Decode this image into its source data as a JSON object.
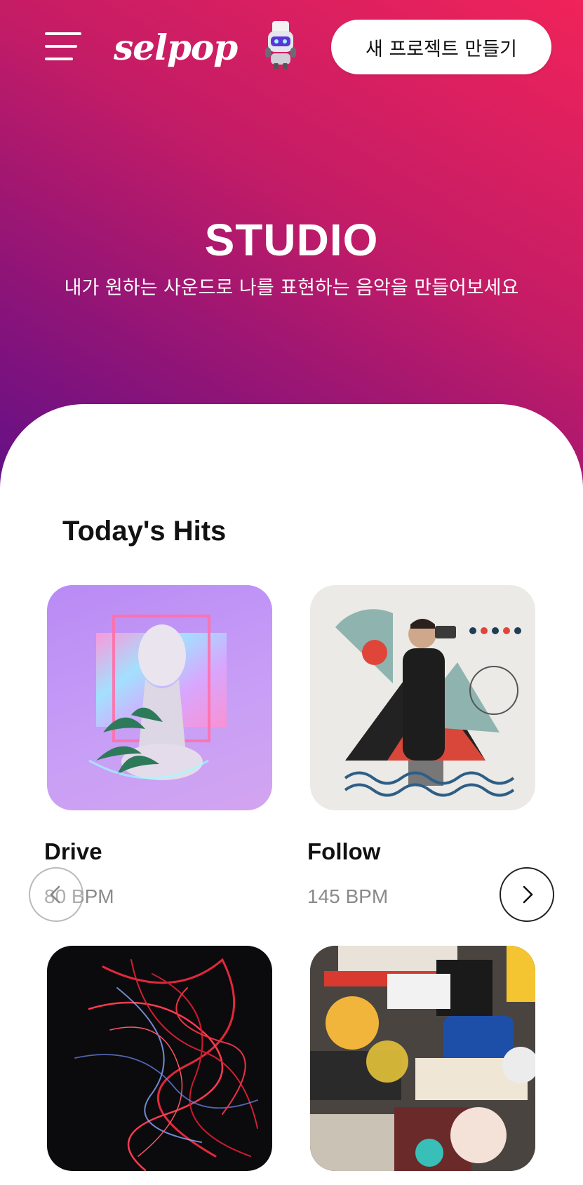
{
  "header": {
    "logo": "selpop",
    "new_project_label": "새 프로젝트 만들기"
  },
  "hero": {
    "title": "STUDIO",
    "subtitle": "내가 원하는 사운드로 나를 표현하는 음악을 만들어보세요",
    "gradient_colors": [
      "#f0235a",
      "#c41c66",
      "#8e1478",
      "#5a0f8a"
    ]
  },
  "todays_hits": {
    "title": "Today's Hits",
    "items": [
      {
        "name": "Drive",
        "bpm": "80 BPM",
        "art": "purple-mannequin-art"
      },
      {
        "name": "Follow",
        "bpm": "145 BPM",
        "art": "retro-collage-art"
      },
      {
        "name": "",
        "bpm": "",
        "art": "red-light-trails-art"
      },
      {
        "name": "",
        "bpm": "",
        "art": "sticker-collage-art"
      }
    ]
  },
  "icons": {
    "menu": "hamburger-menu-icon",
    "mascot": "robot-mascot-icon",
    "prev": "chevron-left-icon",
    "next": "chevron-right-icon"
  }
}
